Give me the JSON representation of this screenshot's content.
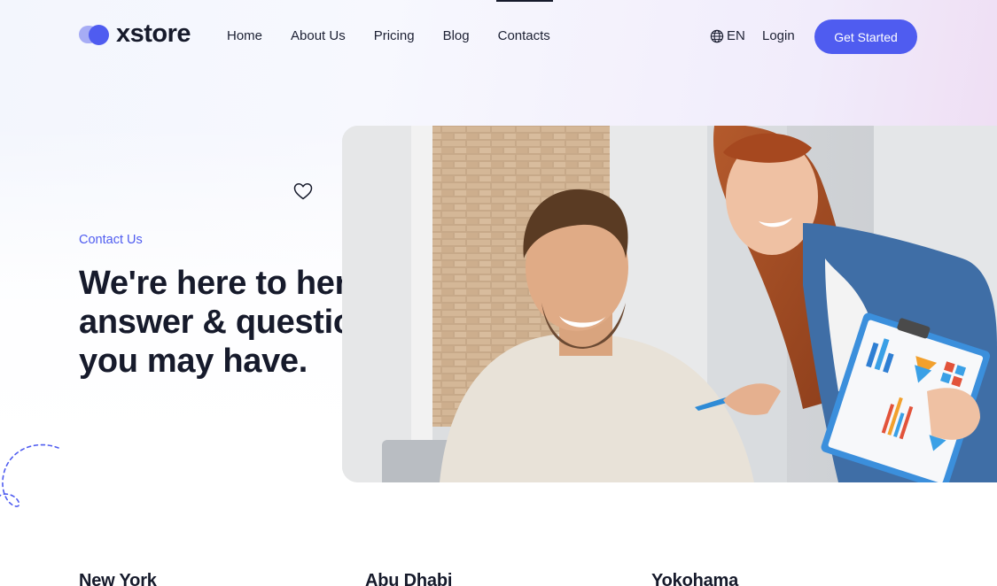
{
  "brand": {
    "name": "xstore",
    "accent": "#4f5cf0"
  },
  "nav": {
    "items": [
      {
        "label": "Home"
      },
      {
        "label": "About Us"
      },
      {
        "label": "Pricing"
      },
      {
        "label": "Blog"
      },
      {
        "label": "Contacts"
      }
    ],
    "language": "EN",
    "login": "Login",
    "cta": "Get Started"
  },
  "hero": {
    "eyebrow": "Contact Us",
    "heading": "We're here to here answer & question you may have.",
    "image_icon": "heart-icon"
  },
  "offices": [
    {
      "city": "New York"
    },
    {
      "city": "Abu Dhabi"
    },
    {
      "city": "Yokohama"
    }
  ]
}
